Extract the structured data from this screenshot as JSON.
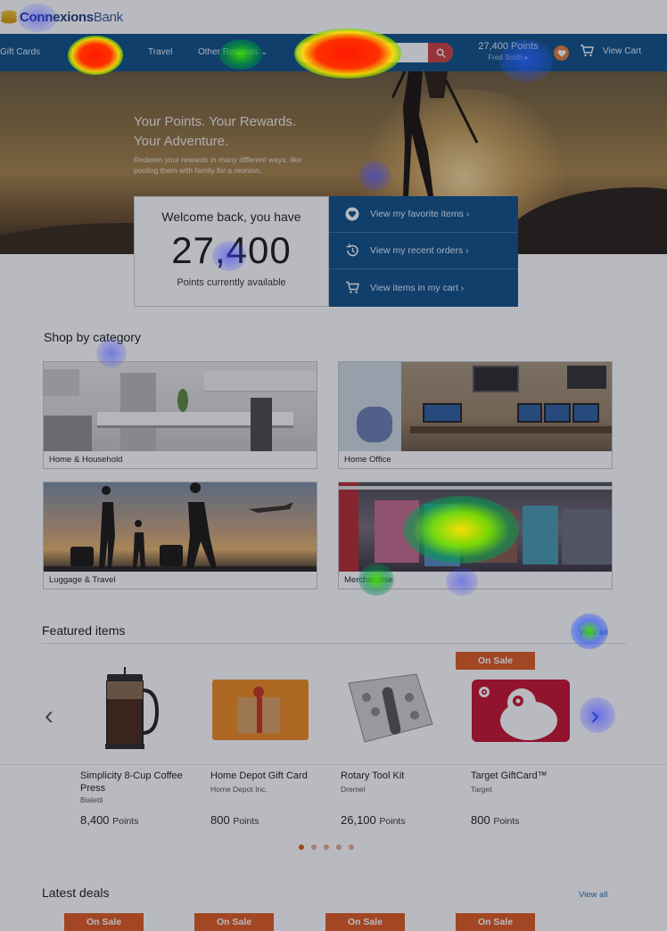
{
  "brand": {
    "name_bold": "Connexions",
    "name_thin": "Bank"
  },
  "nav": {
    "items": [
      "Gift Cards",
      "Merchandise",
      "Travel",
      "Other Rewards"
    ],
    "other_rewards_caret": "⌄",
    "search_placeholder": "Search",
    "points": "27,400 Points",
    "user": "Fred Smith ▸",
    "cart": "View Cart"
  },
  "hero": {
    "title_line1": "Your Points. Your Rewards.",
    "title_line2": "Your Adventure.",
    "subtitle": "Redeem your rewards in many different ways, like pooling them with family for a reunion."
  },
  "welcome": {
    "title": "Welcome back, you have",
    "points": "27,400",
    "subtitle": "Points currently available"
  },
  "quick_links": [
    {
      "label": "View my favorite items  ›",
      "icon": "heart-icon"
    },
    {
      "label": "View my recent orders  ›",
      "icon": "history-icon"
    },
    {
      "label": "View items in my cart  ›",
      "icon": "cart-icon"
    }
  ],
  "shop_by_category": {
    "title": "Shop by category",
    "categories": [
      "Home & Household",
      "Home Office",
      "Luggage & Travel",
      "Merchandise"
    ]
  },
  "featured": {
    "title": "Featured items",
    "view_all": "View all",
    "products": [
      {
        "name": "Simplicity 8-Cup Coffee Press",
        "brand": "Bialetti",
        "points": "8,400",
        "unit": "Points",
        "on_sale": false
      },
      {
        "name": "Home Depot Gift Card",
        "brand": "Home Depot Inc.",
        "points": "800",
        "unit": "Points",
        "on_sale": false
      },
      {
        "name": "Rotary Tool Kit",
        "brand": "Dremel",
        "points": "26,100",
        "unit": "Points",
        "on_sale": false
      },
      {
        "name": "Target GiftCard™",
        "brand": "Target",
        "points": "800",
        "unit": "Points",
        "on_sale": true
      }
    ],
    "on_sale_label": "On Sale",
    "prev_arrow": "‹",
    "next_arrow": "›"
  },
  "latest_deals": {
    "title": "Latest deals",
    "view_all": "View all",
    "badges": [
      "On Sale",
      "On Sale",
      "On Sale",
      "On Sale"
    ]
  },
  "colors": {
    "nav": "#0f4f86",
    "accent": "#e15a20",
    "link": "#2b6ca8"
  }
}
